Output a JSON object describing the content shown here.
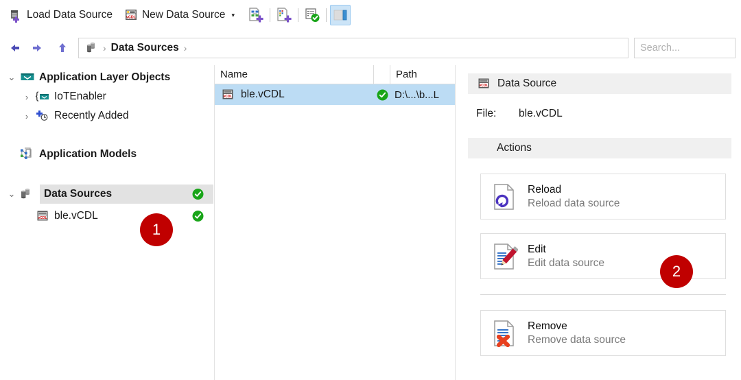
{
  "toolbar": {
    "load_data_source": {
      "label": "Load Data Source",
      "icon": "load-data-source-icon"
    },
    "new_data_source": {
      "label": "New Data Source",
      "icon": "new-data-source-icon",
      "caret": "▾"
    },
    "icon_buttons": [
      {
        "name": "new-application-layer-object-icon"
      },
      {
        "name": "new-application-model-icon"
      },
      {
        "name": "validate-icon"
      },
      {
        "name": "toggle-details-pane-icon",
        "selected": true
      }
    ]
  },
  "navbar": {
    "back_icon": "back-arrow-icon",
    "forward_icon": "forward-arrow-icon",
    "up_icon": "up-arrow-icon",
    "breadcrumb": {
      "root_icon": "data-sources-icon",
      "separator": "›",
      "items": [
        "Data Sources"
      ]
    },
    "search": {
      "placeholder": "Search...",
      "value": "",
      "dropdown_icon": "chevron-down-icon"
    }
  },
  "tree": {
    "items": [
      {
        "label": "Application Layer Objects",
        "icon": "application-layer-objects-icon",
        "expander": "⌄",
        "expanded": true,
        "bold": true,
        "indent": 0,
        "status": ""
      },
      {
        "label": "IoTEnabler",
        "icon": "iot-enabler-icon",
        "expander": "›",
        "expanded": false,
        "bold": false,
        "indent": 1,
        "status": ""
      },
      {
        "label": "Recently Added",
        "icon": "recently-added-icon",
        "expander": "›",
        "expanded": false,
        "bold": false,
        "indent": 1,
        "status": ""
      },
      {
        "label": "Application Models",
        "icon": "application-models-icon",
        "expander": "",
        "expanded": false,
        "bold": true,
        "indent": 0,
        "status": ""
      },
      {
        "label": "Data Sources",
        "icon": "data-sources-icon",
        "expander": "⌄",
        "expanded": true,
        "bold": true,
        "indent": 0,
        "selected": true,
        "status": "ok"
      },
      {
        "label": "ble.vCDL",
        "icon": "vcdl-file-icon",
        "expander": "",
        "expanded": false,
        "bold": false,
        "indent": 1,
        "status": "ok"
      }
    ]
  },
  "list_view": {
    "columns": [
      "Name",
      "",
      "Path"
    ],
    "rows": [
      {
        "name": "ble.vCDL",
        "icon": "vcdl-file-icon",
        "status": "ok",
        "path": "D:\\...\\b...L",
        "selected": true
      }
    ]
  },
  "details": {
    "header": {
      "title": "Data Source",
      "icon": "vcdl-file-icon"
    },
    "file_label": "File:",
    "file_value": "ble.vCDL",
    "actions_header": "Actions",
    "actions": [
      {
        "title": "Reload",
        "subtitle": "Reload data source",
        "icon": "reload-document-icon"
      },
      {
        "title": "Edit",
        "subtitle": "Edit data source",
        "icon": "edit-document-icon"
      },
      {
        "title": "Remove",
        "subtitle": "Remove data source",
        "icon": "remove-document-icon"
      }
    ]
  },
  "callouts": [
    {
      "number": "1",
      "color": "#c00000"
    },
    {
      "number": "2",
      "color": "#c00000"
    }
  ]
}
